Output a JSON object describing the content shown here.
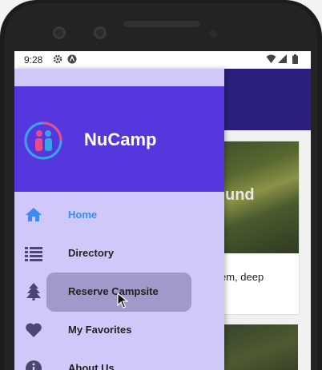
{
  "statusbar": {
    "time": "9:28",
    "left_icons": [
      "gear-icon",
      "app-notification-icon"
    ],
    "right_icons": [
      "wifi-icon",
      "signal-icon",
      "battery-icon"
    ]
  },
  "background_app": {
    "card_title": "round",
    "card_text": "em, deep"
  },
  "drawer": {
    "brand": "NuCamp",
    "items": [
      {
        "label": "Home",
        "icon": "home-icon",
        "active": true
      },
      {
        "label": "Directory",
        "icon": "list-icon",
        "active": false
      },
      {
        "label": "Reserve Campsite",
        "icon": "tree-icon",
        "active": false
      },
      {
        "label": "My Favorites",
        "icon": "heart-icon",
        "active": false
      },
      {
        "label": "About Us",
        "icon": "info-icon",
        "active": false
      }
    ]
  },
  "colors": {
    "drawer_header": "#5637dd",
    "drawer_bg": "#d1c8fa",
    "active_item": "#3d8af5",
    "app_header": "#2a1f7e"
  }
}
